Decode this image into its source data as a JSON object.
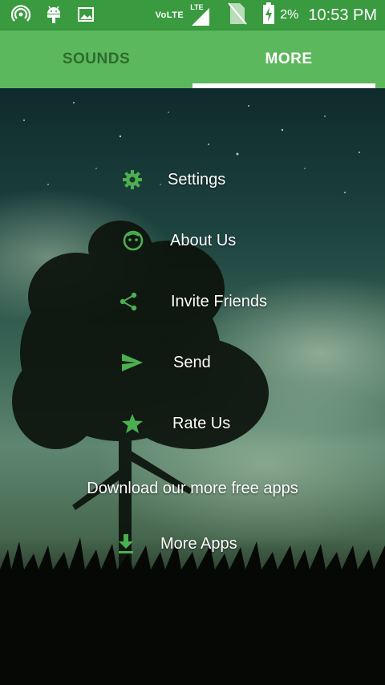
{
  "status_bar": {
    "network_label": "VoLTE",
    "signal_label": "LTE",
    "battery_percent": "2%",
    "time": "10:53 PM",
    "icons": [
      "hotspot-icon",
      "android-icon",
      "image-icon",
      "signal-icon",
      "no-sim-icon",
      "battery-charging-icon"
    ]
  },
  "tabs": [
    {
      "label": "SOUNDS",
      "active": false
    },
    {
      "label": "MORE",
      "active": true
    }
  ],
  "menu": {
    "items": [
      {
        "label": "Settings",
        "icon": "gear-icon"
      },
      {
        "label": "About Us",
        "icon": "face-icon"
      },
      {
        "label": "Invite Friends",
        "icon": "share-icon"
      },
      {
        "label": "Send",
        "icon": "send-icon"
      },
      {
        "label": "Rate Us",
        "icon": "star-icon"
      }
    ],
    "download_text": "Download our more free apps",
    "more_apps": {
      "label": "More Apps",
      "icon": "download-icon"
    }
  },
  "colors": {
    "status_bar": "#3a9a3f",
    "tab_bar": "#5cb85c",
    "tab_inactive_text": "#2e6b30",
    "tab_active_text": "#ffffff",
    "icon_green": "#4caf50"
  }
}
